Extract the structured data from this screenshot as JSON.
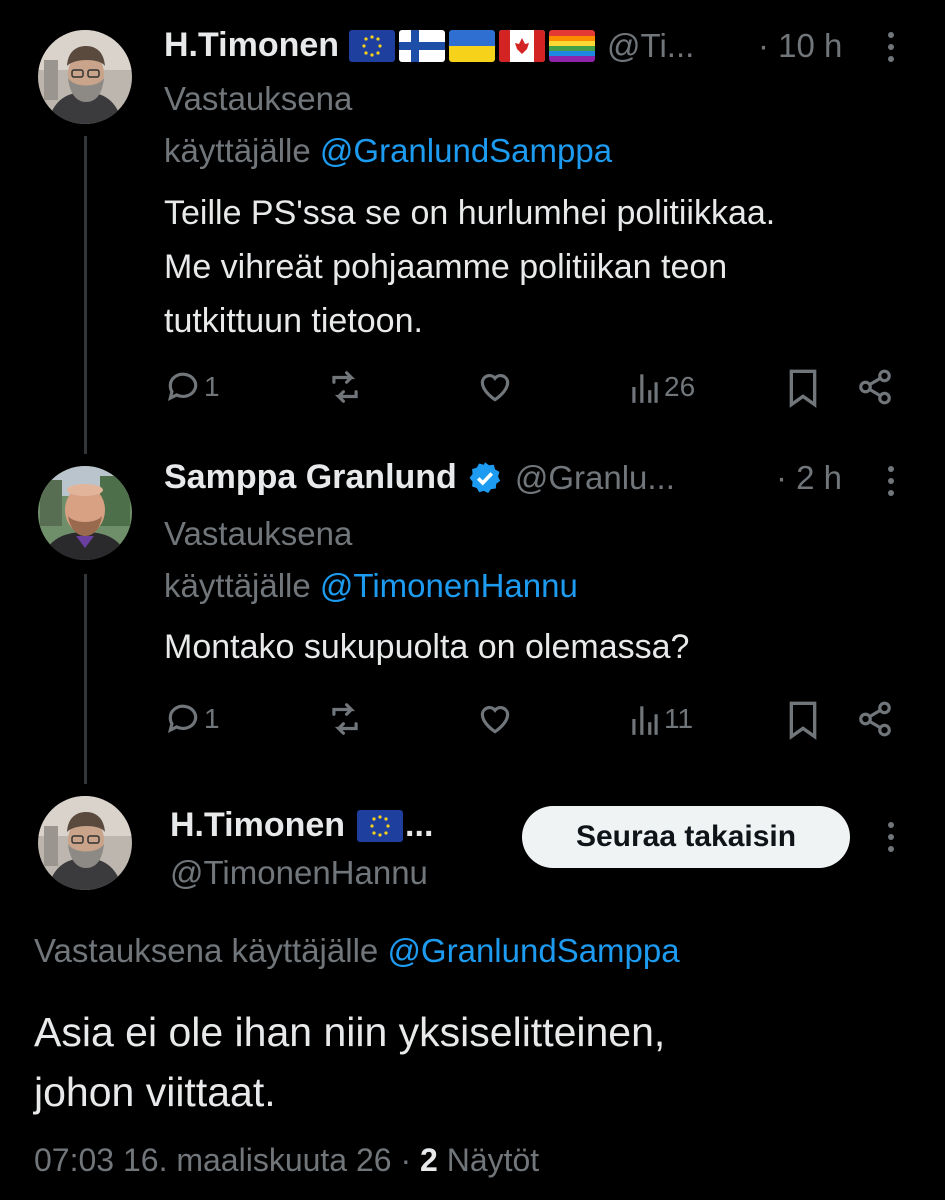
{
  "tweet1": {
    "display_name": "H.Timonen",
    "handle": "@Ti...",
    "time": "· 10 h",
    "reply_prefix": "Vastauksena",
    "reply_to_prefix": "käyttäjälle",
    "reply_to_handle": "@GranlundSamppa",
    "text_lines": [
      "Teille PS'ssa se on hurlumhei politiikkaa.",
      "Me vihreät pohjaamme politiikan teon",
      "tutkittuun tietoon."
    ],
    "flags": [
      "eu-flag",
      "finland-flag",
      "ukraine-flag",
      "canada-flag",
      "rainbow-flag"
    ],
    "actions": {
      "replies": "1",
      "views": "26"
    }
  },
  "tweet2": {
    "display_name": "Samppa Granlund",
    "handle": "@Granlu...",
    "time": "· 2 h",
    "verified": true,
    "reply_prefix": "Vastauksena",
    "reply_to_prefix": "käyttäjälle",
    "reply_to_handle": "@TimonenHannu",
    "text_lines": [
      "Montako sukupuolta on olemassa?"
    ],
    "actions": {
      "replies": "1",
      "views": "11"
    }
  },
  "main_tweet": {
    "display_name": "H.Timonen",
    "name_suffix": "...",
    "handle": "@TimonenHannu",
    "follow_label": "Seuraa takaisin",
    "reply_prefix": "Vastauksena käyttäjälle",
    "reply_to_handle": "@GranlundSamppa",
    "text_lines": [
      "Asia ei ole ihan niin yksiselitteinen,",
      "johon viittaat."
    ],
    "timestamp": "07:03 16. maaliskuuta 26",
    "separator": "·",
    "views_count": "2",
    "views_label": "Näytöt"
  },
  "colors": {
    "background": "#000000",
    "text": "#e7e9ea",
    "muted": "#71767b",
    "link": "#1d9bf0",
    "verified": "#1d9bf0"
  }
}
